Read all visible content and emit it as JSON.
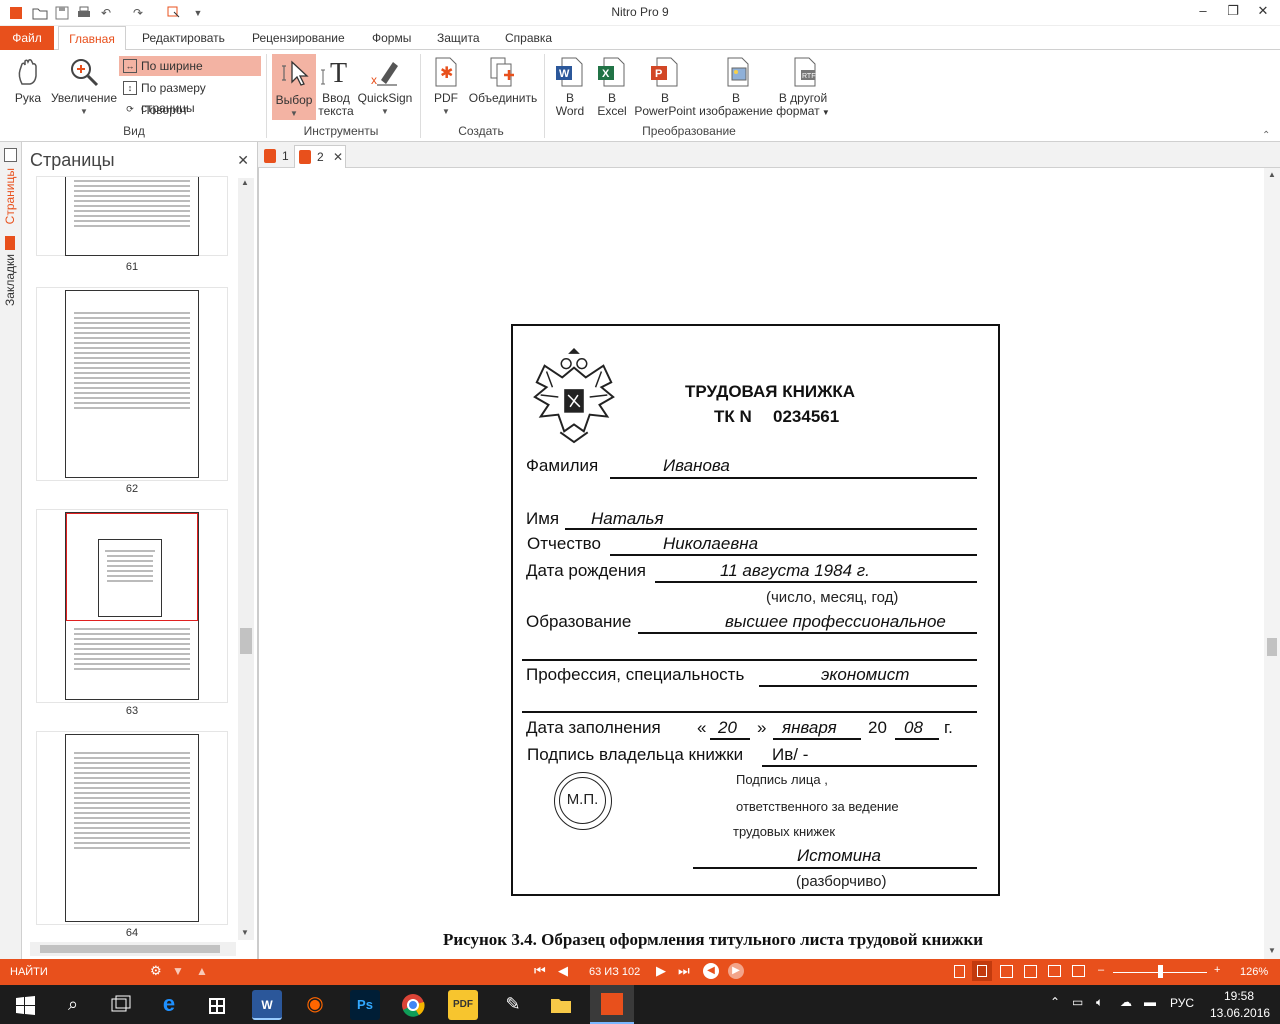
{
  "app": {
    "title": "Nitro Pro 9"
  },
  "tabs": {
    "file": "Файл",
    "items": [
      "Главная",
      "Редактировать",
      "Рецензирование",
      "Формы",
      "Защита",
      "Справка"
    ]
  },
  "ribbon": {
    "hand": "Рука",
    "zoom": "Увеличение",
    "view_options": [
      "По ширине",
      "По размеру страницы",
      "Поворот"
    ],
    "group_view": "Вид",
    "select": "Выбор",
    "type_line1": "Ввод",
    "type_line2": "текста",
    "quicksign": "QuickSign",
    "group_tools": "Инструменты",
    "pdf": "PDF",
    "combine": "Объединить",
    "group_create": "Создать",
    "to_word_1": "В",
    "to_word_2": "Word",
    "to_excel_1": "В",
    "to_excel_2": "Excel",
    "to_ppt_1": "В",
    "to_ppt_2": "PowerPoint",
    "to_img_1": "В",
    "to_img_2": "изображение",
    "to_other_1": "В другой",
    "to_other_2": "формат",
    "group_convert": "Преобразование"
  },
  "left_tabs": {
    "pages": "Страницы",
    "bookmarks": "Закладки"
  },
  "panel": {
    "title": "Страницы",
    "pages": [
      "61",
      "62",
      "63",
      "64"
    ]
  },
  "doc_tabs": [
    "1",
    "2"
  ],
  "card": {
    "title": "ТРУДОВАЯ КНИЖКА",
    "number_prefix": "ТК N",
    "number": "0234561",
    "surname_label": "Фамилия",
    "surname": "Иванова",
    "name_label": "Имя",
    "name": "Наталья",
    "patronymic_label": "Отчество",
    "patronymic": "Николаевна",
    "birth_label": "Дата рождения",
    "birth": "11 августа 1984 г.",
    "birth_hint": "(число, месяц, год)",
    "edu_label": "Образование",
    "edu": "высшее профессиональное",
    "prof_label": "Профессия, специальность",
    "prof": "экономист",
    "fill_label": "Дата заполнения",
    "q_open": "«",
    "day": "20",
    "q_close": "»",
    "month": "января",
    "year_prefix": "20",
    "year": "08",
    "year_suffix": "г.",
    "owner_sign_label": "Подпись владельца книжки",
    "owner_sign": "Ив/ -",
    "stamp": "М.П.",
    "resp_1": "Подпись лица ,",
    "resp_2": "ответственного за ведение",
    "resp_3": "трудовых книжек",
    "resp_name": "Истомина",
    "resp_hint": "(разборчиво)"
  },
  "caption": "Рисунок 3.4. Образец оформления титульного листа трудовой книжки",
  "status": {
    "find": "НАЙТИ",
    "page": "63 ИЗ 102",
    "zoom": "126%"
  },
  "taskbar": {
    "lang": "РУС",
    "time": "19:58",
    "date": "13.06.2016"
  },
  "colors": {
    "accent": "#e8501c",
    "taskbar": "#1c1c1c"
  }
}
